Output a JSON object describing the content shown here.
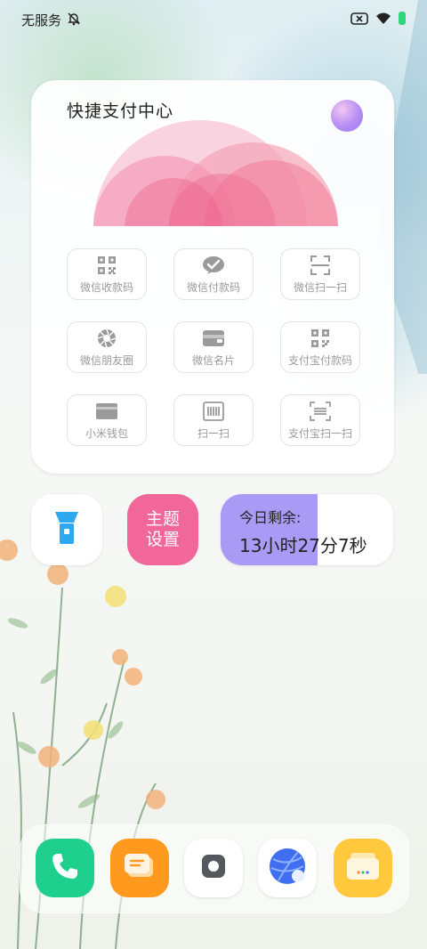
{
  "status_bar": {
    "carrier": "无服务",
    "icons": [
      "bell-off-icon",
      "battery-saver-x-icon",
      "wifi-icon",
      "battery-icon"
    ]
  },
  "widget": {
    "title": "快捷支付中心",
    "tiles": [
      {
        "label": "微信收款码",
        "icon": "qr-code-icon"
      },
      {
        "label": "微信付款码",
        "icon": "wechat-pay-icon"
      },
      {
        "label": "微信扫一扫",
        "icon": "scan-frame-icon"
      },
      {
        "label": "微信朋友圈",
        "icon": "camera-shutter-icon"
      },
      {
        "label": "微信名片",
        "icon": "wallet-card-icon"
      },
      {
        "label": "支付宝付款码",
        "icon": "qr-code-icon"
      },
      {
        "label": "小米钱包",
        "icon": "wallet-icon"
      },
      {
        "label": "扫一扫",
        "icon": "barcode-scan-icon"
      },
      {
        "label": "支付宝扫一扫",
        "icon": "scan-barcode-icon"
      }
    ]
  },
  "shortcuts": {
    "flashlight_icon": "flashlight-icon",
    "theme_label_line1": "主题",
    "theme_label_line2": "设置",
    "remaining_title": "今日剩余:",
    "remaining_time": "13小时27分7秒",
    "remaining_fraction": 0.56
  },
  "dock": {
    "apps": [
      {
        "name": "phone",
        "icon": "phone-icon"
      },
      {
        "name": "messages",
        "icon": "message-icon"
      },
      {
        "name": "settings",
        "icon": "gear-icon"
      },
      {
        "name": "browser",
        "icon": "globe-icon"
      },
      {
        "name": "gallery",
        "icon": "gallery-icon"
      }
    ]
  },
  "colors": {
    "theme_button": "#f2679a",
    "remaining_fill": "#a99af5",
    "phone": "#1fcf8e",
    "messages": "#ff9a1f",
    "gallery": "#ffc83d"
  }
}
